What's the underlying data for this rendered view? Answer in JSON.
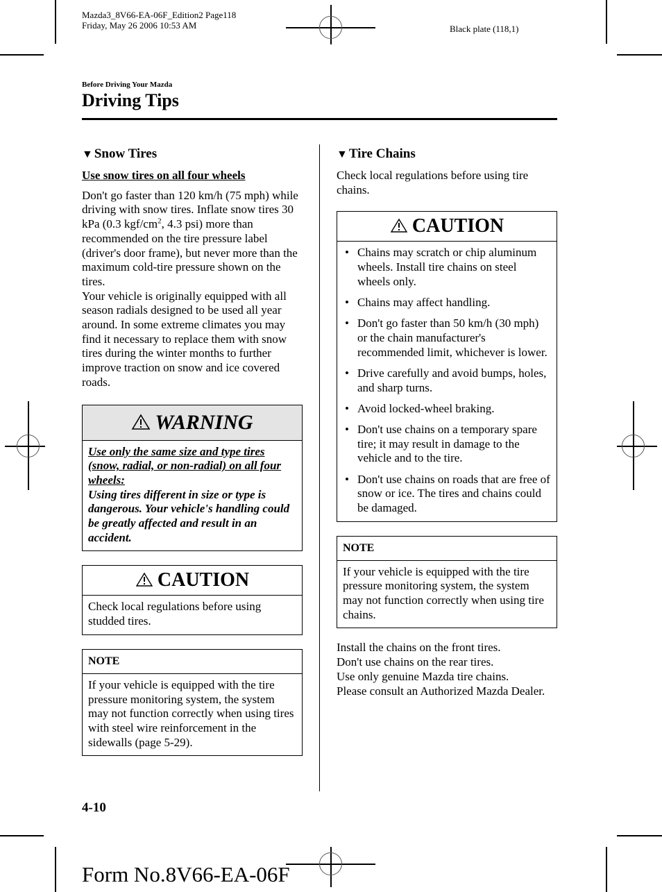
{
  "print_meta": {
    "file_line": "Mazda3_8V66-EA-06F_Edition2 Page118",
    "date_line": "Friday, May 26 2006 10:53 AM",
    "plate": "Black plate (118,1)"
  },
  "header": {
    "section": "Before Driving Your Mazda",
    "title": "Driving Tips"
  },
  "left_column": {
    "heading_marker": "▼",
    "heading": "Snow Tires",
    "subheading": "Use snow tires on all four wheels",
    "para1_a": "Don't go faster than 120 km/h (75 mph) while driving with snow tires. Inflate snow tires 30 kPa (0.3 kgf/cm",
    "para1_sup": "2",
    "para1_b": ", 4.3 psi) more than recommended on the tire pressure label (driver's door frame), but never more than the maximum cold-tire pressure shown on the tires.",
    "para2": "Your vehicle is originally equipped with all season radials designed to be used all year around. In some extreme climates you may find it necessary to replace them with snow tires during the winter months to further improve traction on snow and ice covered roads.",
    "warning": {
      "title": "WARNING",
      "underlined": "Use only the same size and type tires (snow, radial, or non-radial) on all four wheels:",
      "text": "Using tires different in size or type is dangerous. Your vehicle's handling could be greatly affected and result in an accident."
    },
    "caution": {
      "title": "CAUTION",
      "text": "Check local regulations before using studded tires."
    },
    "note": {
      "title": "NOTE",
      "text": "If your vehicle is equipped with the tire pressure monitoring system, the system may not function correctly when using tires with steel wire reinforcement in the sidewalls (page 5-29)."
    }
  },
  "right_column": {
    "heading_marker": "▼",
    "heading": "Tire Chains",
    "intro": "Check local regulations before using tire chains.",
    "caution": {
      "title": "CAUTION",
      "items": [
        "Chains may scratch or chip aluminum wheels. Install tire chains on steel wheels only.",
        "Chains may affect handling.",
        "Don't go faster than 50 km/h (30 mph) or the chain manufacturer's recommended limit, whichever is lower.",
        "Drive carefully and avoid bumps, holes, and sharp turns.",
        "Avoid locked-wheel braking.",
        "Don't use chains on a temporary spare tire; it may result in damage to the vehicle and to the tire.",
        "Don't use chains on roads that are free of snow or ice. The tires and chains could be damaged."
      ]
    },
    "note": {
      "title": "NOTE",
      "text": "If your vehicle is equipped with the tire pressure monitoring system, the system may not function correctly when using tire chains."
    },
    "closing_lines": [
      "Install the chains on the front tires.",
      "Don't use chains on the rear tires.",
      "Use only genuine Mazda tire chains.",
      "Please consult an Authorized Mazda Dealer."
    ]
  },
  "footer": {
    "page_number": "4-10",
    "form_number": "Form No.8V66-EA-06F"
  },
  "icons": {
    "warning": "alert-triangle-icon",
    "caution": "alert-triangle-icon",
    "heading_marker": "down-triangle-icon",
    "registration": "crosshair-registration-mark"
  }
}
